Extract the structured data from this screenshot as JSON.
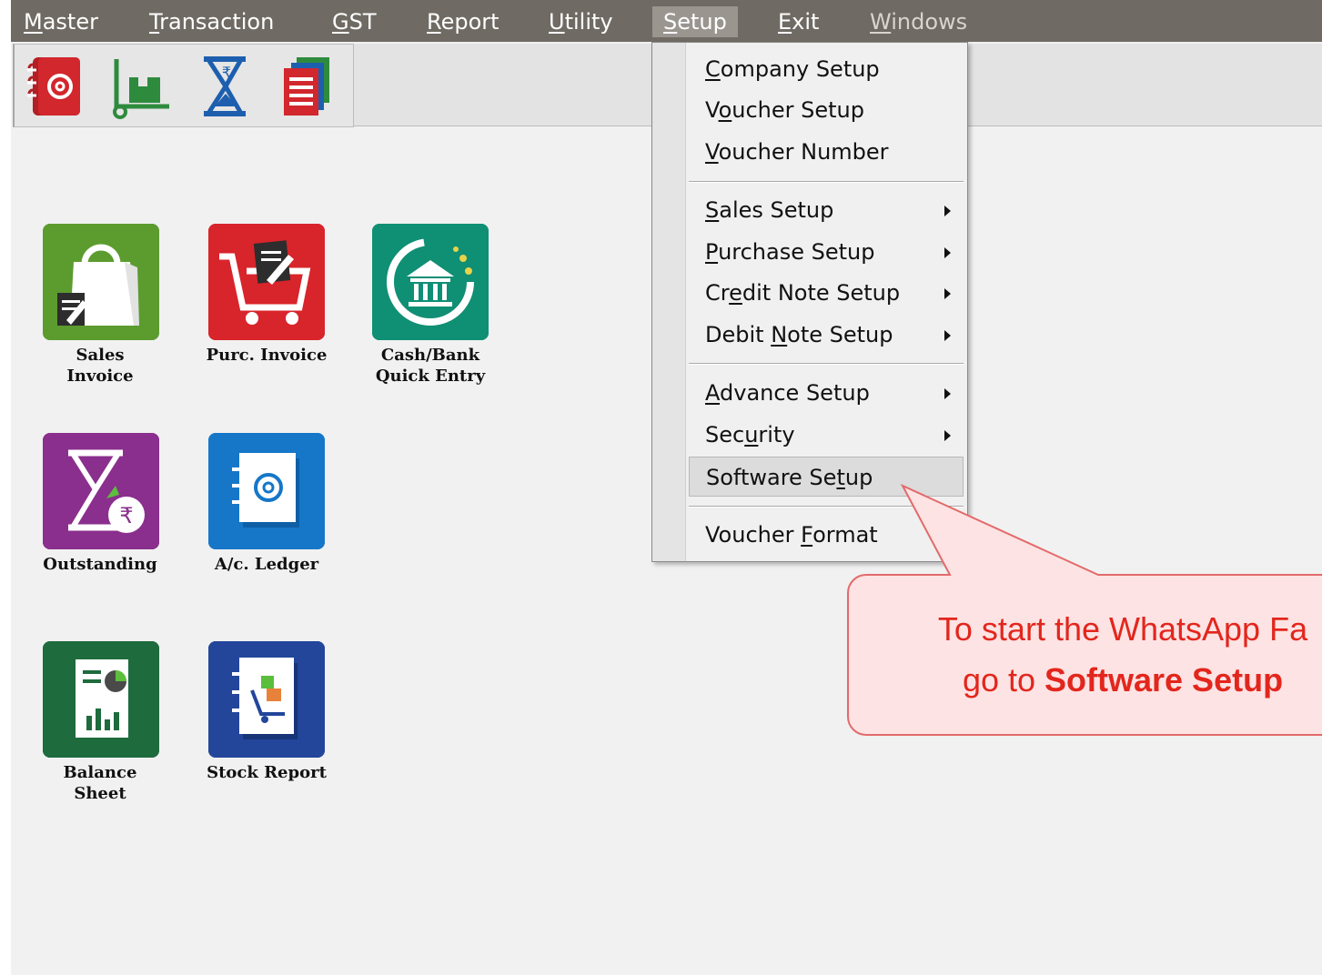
{
  "menubar": {
    "items": [
      {
        "label": "Master",
        "ul": "M",
        "rest": "aster"
      },
      {
        "label": "Transaction",
        "ul": "T",
        "rest": "ransaction"
      },
      {
        "label": "GST",
        "ul": "G",
        "rest": "ST"
      },
      {
        "label": "Report",
        "ul": "R",
        "rest": "eport"
      },
      {
        "label": "Utility",
        "ul": "U",
        "rest": "tility"
      },
      {
        "label": "Setup",
        "ul": "S",
        "rest": "etup"
      },
      {
        "label": "Exit",
        "ul": "E",
        "rest": "xit"
      },
      {
        "label": "Windows",
        "ul": "W",
        "rest": "indows"
      }
    ]
  },
  "toolbar": {
    "icons": [
      "ledger-book-icon",
      "stock-trolley-icon",
      "hourglass-icon",
      "report-pages-icon"
    ]
  },
  "tiles": [
    {
      "label_line1": "Sales",
      "label_line2": "Invoice",
      "icon": "shopping-bag-icon",
      "color": "#5a9a2e"
    },
    {
      "label_line1": "Purc. Invoice",
      "label_line2": "",
      "icon": "cart-icon",
      "color": "#d8242b"
    },
    {
      "label_line1": "Cash/Bank",
      "label_line2": "Quick Entry",
      "icon": "bank-icon",
      "color": "#0f8f74"
    },
    {
      "label_line1": "Outstanding",
      "label_line2": "",
      "icon": "hourglass-rupee-icon",
      "color": "#8a2f8d"
    },
    {
      "label_line1": "A/c. Ledger",
      "label_line2": "",
      "icon": "address-book-icon",
      "color": "#1677c8"
    },
    {
      "label_line1": "Balance",
      "label_line2": "Sheet",
      "icon": "chart-document-icon",
      "color": "#1e6b3d"
    },
    {
      "label_line1": "Stock Report",
      "label_line2": "",
      "icon": "stock-notebook-icon",
      "color": "#23469b"
    }
  ],
  "setup_menu": {
    "items": [
      {
        "pre": "",
        "ul": "C",
        "post": "ompany Setup",
        "submenu": false
      },
      {
        "pre": "V",
        "ul": "o",
        "post": "ucher Setup",
        "submenu": false
      },
      {
        "pre": "",
        "ul": "V",
        "post": "oucher Number",
        "submenu": false
      },
      {
        "pre": "",
        "ul": "S",
        "post": "ales Setup",
        "submenu": true
      },
      {
        "pre": "",
        "ul": "P",
        "post": "urchase Setup",
        "submenu": true
      },
      {
        "pre": "Cr",
        "ul": "e",
        "post": "dit Note Setup",
        "submenu": true
      },
      {
        "pre": "Debit ",
        "ul": "N",
        "post": "ote Setup",
        "submenu": true
      },
      {
        "pre": "",
        "ul": "A",
        "post": "dvance Setup",
        "submenu": true
      },
      {
        "pre": "Sec",
        "ul": "u",
        "post": "rity",
        "submenu": true
      },
      {
        "pre": "Software Se",
        "ul": "t",
        "post": "up",
        "submenu": false
      },
      {
        "pre": "Voucher ",
        "ul": "F",
        "post": "ormat",
        "submenu": false
      }
    ]
  },
  "callout": {
    "line1": "To start the WhatsApp Fa",
    "line2_prefix": "go to ",
    "line2_bold": "Software Setup"
  },
  "colors": {
    "menubar": "#6f6a63",
    "callout_text": "#e3261d",
    "callout_fill": "#fde3e3",
    "callout_border": "#e36a6a"
  }
}
